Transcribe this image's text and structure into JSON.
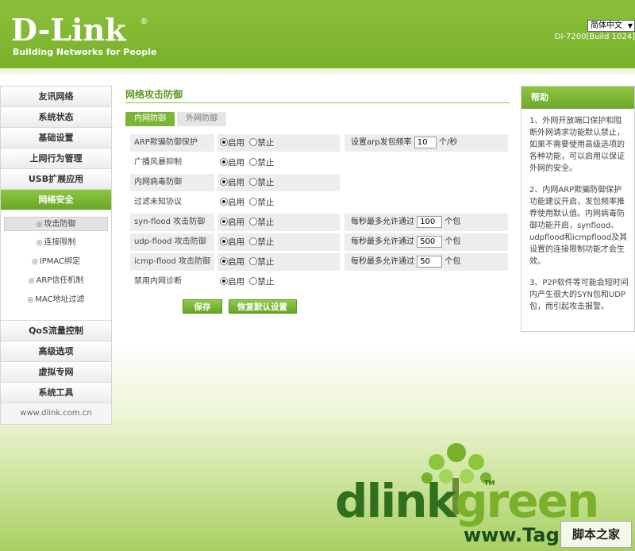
{
  "header": {
    "brand": "D-Link",
    "registered": "®",
    "tagline": "Building Networks for People",
    "language": "简体中文",
    "model": "DI-7200[Build 1024]"
  },
  "sidebar": {
    "items_top": [
      {
        "label": "友讯网络"
      },
      {
        "label": "系统状态"
      },
      {
        "label": "基础设置"
      },
      {
        "label": "上网行为管理"
      },
      {
        "label": "USB扩展应用"
      },
      {
        "label": "网络安全"
      }
    ],
    "sub_items": [
      {
        "label": "攻击防御"
      },
      {
        "label": "连接限制"
      },
      {
        "label": "IPMAC绑定"
      },
      {
        "label": "ARP信任机制"
      },
      {
        "label": "MAC地址过滤"
      }
    ],
    "items_bottom": [
      {
        "label": "QoS流量控制"
      },
      {
        "label": "高级选项"
      },
      {
        "label": "虚拟专网"
      },
      {
        "label": "系统工具"
      }
    ],
    "footer": "www.dlink.com.cn"
  },
  "main": {
    "title": "网络攻击防御",
    "tabs": [
      {
        "label": "内网防御"
      },
      {
        "label": "外网防御"
      }
    ],
    "enable_label": "启用",
    "disable_label": "禁止",
    "rows": [
      {
        "label": "ARP欺骗防御保护",
        "extra_prefix": "设置arp发包频率",
        "extra_value": "10",
        "extra_suffix": "个/秒"
      },
      {
        "label": "广播风暴抑制"
      },
      {
        "label": "内网病毒防御"
      },
      {
        "label": "过滤未知协议"
      },
      {
        "label": "syn-flood 攻击防御",
        "extra_prefix": "每秒最多允许通过",
        "extra_value": "100",
        "extra_suffix": "个包"
      },
      {
        "label": "udp-flood 攻击防御",
        "extra_prefix": "每秒最多允许通过",
        "extra_value": "500",
        "extra_suffix": "个包"
      },
      {
        "label": "icmp-flood 攻击防御",
        "extra_prefix": "每秒最多允许通过",
        "extra_value": "50",
        "extra_suffix": "个包"
      },
      {
        "label": "禁用内网诊断"
      }
    ],
    "save_label": "保存",
    "restore_label": "恢复默认设置"
  },
  "help": {
    "title": "帮助",
    "paragraphs": [
      "1、外网开放端口保护和阻断外网请求功能默认禁止，如果不需要使用高级选项的各种功能，可以启用以保证外网的安全。",
      "2、内网ARP欺骗防御保护功能建议开启，发包频率推荐使用默认值。内网病毒防御功能开启，synflood、udpflood和icmpflood及其设置的连接限制功能才会生效。",
      "3、P2P软件等可能会短时间内产生很大的SYN包和UDP包，而引起攻击报警。"
    ]
  },
  "branding": {
    "dlink_text": "dlink",
    "green_text": "green",
    "tm": "TM",
    "watermark": "www.Tag",
    "watermark_box": "脚本之家"
  },
  "colors": {
    "brand_green": "#79b12a",
    "accent_green": "#7ab534",
    "dark_green": "#2f6f1e"
  }
}
